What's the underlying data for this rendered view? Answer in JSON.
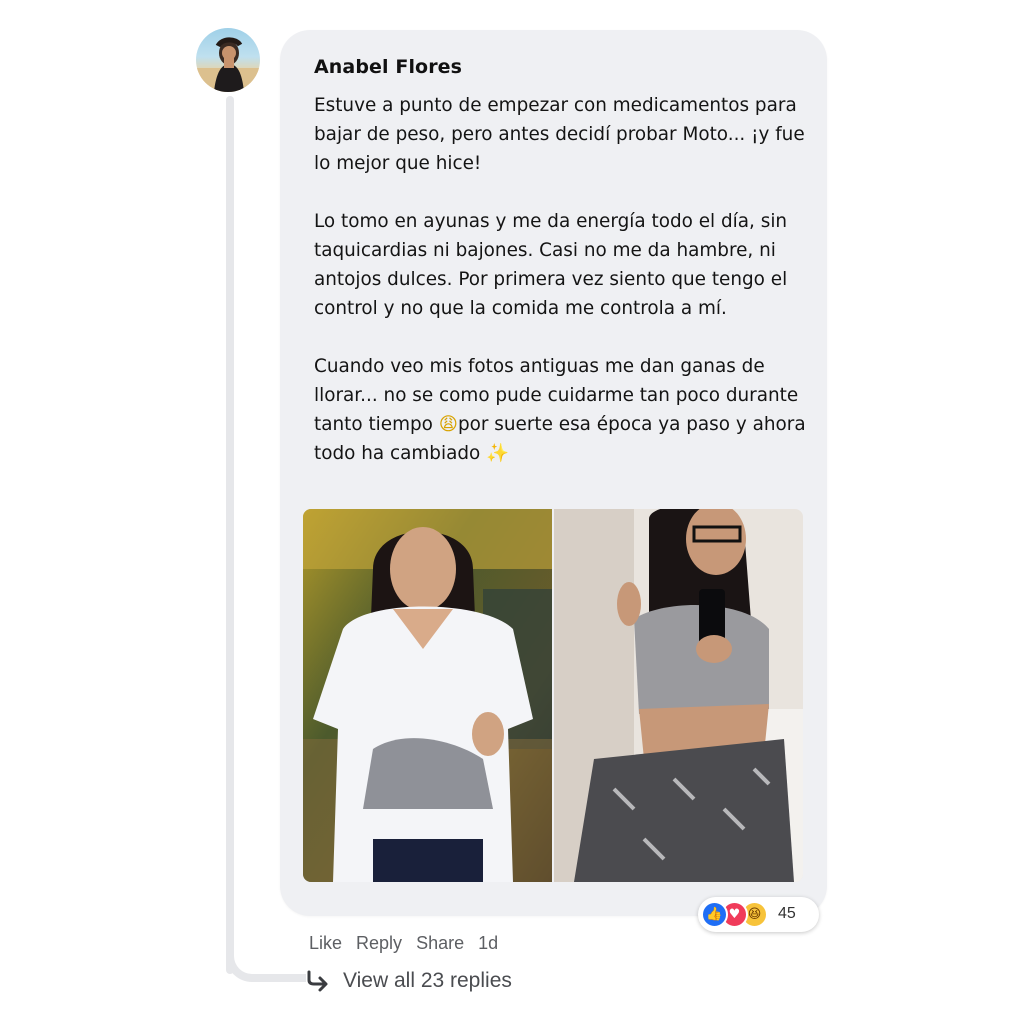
{
  "comment": {
    "author": "Anabel Flores",
    "paragraphs": [
      "Estuve a punto de empezar con medicamentos para bajar de peso, pero antes decidí probar Moto... ¡y fue lo mejor que hice!",
      "Lo tomo en ayunas y me da energía todo el día, sin taquicardias ni bajones. Casi no me da hambre, ni antojos dulces. Por primera vez siento que tengo el control y no que la comida me controla a mí."
    ],
    "paragraph3_part1": "Cuando veo mis fotos antiguas me dan ganas de llorar... no se como pude cuidarme tan poco durante tanto tiempo ",
    "emoji_weary": "😩",
    "paragraph3_part2": "por suerte esa época ya paso y ahora todo ha cambiado ",
    "emoji_sparkles": "✨"
  },
  "reactions": {
    "icons": [
      "like-icon",
      "love-icon",
      "haha-icon"
    ],
    "count": "45",
    "colors": {
      "like": "#1f6ef5",
      "love": "#f03b5a",
      "haha": "#f7c33a"
    }
  },
  "actions": {
    "like": "Like",
    "reply": "Reply",
    "share": "Share",
    "time": "1d"
  },
  "replies": {
    "label": "View all 23 replies",
    "icon": "reply-arrow-icon"
  }
}
